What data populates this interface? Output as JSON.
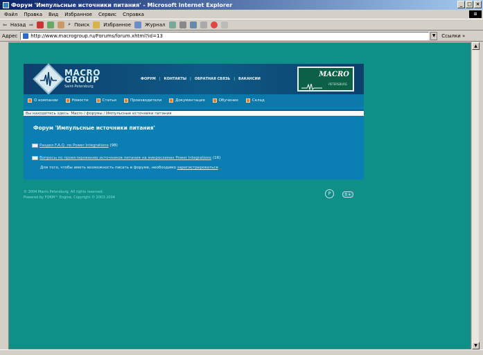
{
  "window": {
    "title": "Форум 'Импульсные источники питания' - Microsoft Internet Explorer",
    "buttons": {
      "minimize": "_",
      "maximize": "□",
      "close": "×"
    }
  },
  "menubar": {
    "items": [
      "Файл",
      "Правка",
      "Вид",
      "Избранное",
      "Сервис",
      "Справка"
    ]
  },
  "toolbar": {
    "back": "Назад",
    "search": "Поиск",
    "favorites": "Избранное",
    "journal": "Журнал"
  },
  "address": {
    "label": "Адрес",
    "url": "http://www.macrogroup.ru/Forums/forum.xhtml?id=13",
    "go": "Ссылки »"
  },
  "site": {
    "logo": {
      "line1": "MACRO",
      "line2": "GROUP",
      "sub": "Saint-Petersburg"
    },
    "header_nav": [
      "ФОРУМ",
      "КОНТАКТЫ",
      "ОБРАТНАЯ СВЯЗЬ",
      "ВАКАНСИИ"
    ],
    "badge": {
      "text": "MACRO",
      "sub": "PETERSBURG"
    },
    "nav": [
      "О компании",
      "Новости",
      "Статьи",
      "Производители",
      "Документация",
      "Обучение",
      "Склад"
    ],
    "breadcrumb": "Вы находитесь здесь: Macro / форумы / Импульсные источники питания",
    "forum_title": "Форум 'Импульсные источники питания'",
    "forums": [
      {
        "link": "Раздел F.A.Q. по Power Integrations",
        "count": "(98)"
      },
      {
        "link": "Вопросы по проектированию источников питания на микросхемах Power Integrations",
        "count": "(16)"
      }
    ],
    "register_text": "Для того, чтобы иметь возможность писать в форуме, необходимо",
    "register_link": "зарегистрироваться",
    "copyright_1": "© 2004 Macro Petersburg. All rights reserved.",
    "copyright_2": "Powered by FORM™ Engine. Copyright © 2003-2004",
    "badge_p": "P",
    "badge_vote": "3 +"
  },
  "colors": {
    "page_background": "#0e9088",
    "site_panel": "#0b7fb3",
    "header_dark": "#0d3f6d",
    "nav_bullet": "#e87b2a"
  }
}
